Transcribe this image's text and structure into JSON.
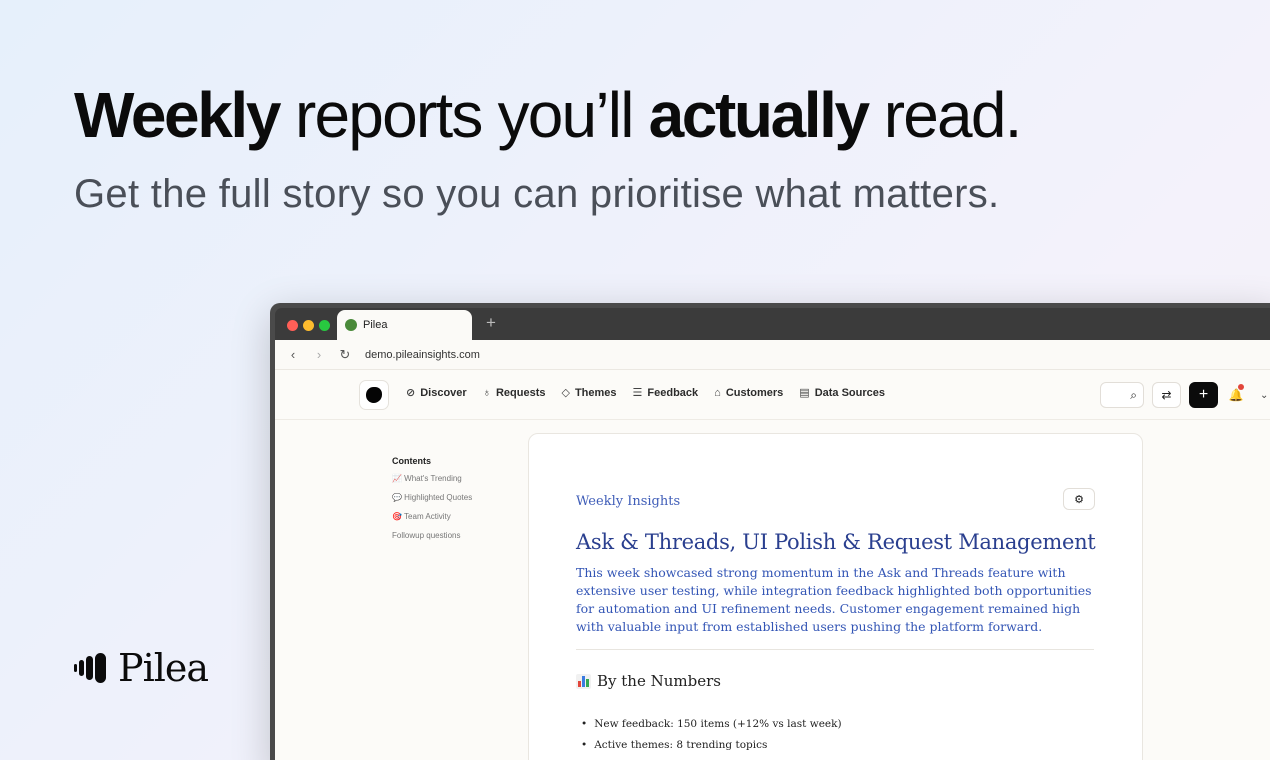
{
  "hero": {
    "headline_part1": "Weekly",
    "headline_part2": " reports you’ll ",
    "headline_part3": "actually",
    "headline_part4": " read.",
    "subline": "Get the full story so you can prioritise what matters."
  },
  "brand": {
    "name": "Pilea"
  },
  "browser": {
    "tab_title": "Pilea",
    "url": "demo.pileainsights.com",
    "colors": {
      "close": "#ff5f57",
      "minimize": "#febc2e",
      "maximize": "#28c840"
    }
  },
  "nav": {
    "items": [
      {
        "label": "Discover",
        "icon": "compass-icon",
        "glyph": "⊘"
      },
      {
        "label": "Requests",
        "icon": "lightbulb-icon",
        "glyph": "♁"
      },
      {
        "label": "Themes",
        "icon": "tag-icon",
        "glyph": "◇"
      },
      {
        "label": "Feedback",
        "icon": "list-icon",
        "glyph": "☰"
      },
      {
        "label": "Customers",
        "icon": "building-icon",
        "glyph": "⌂"
      },
      {
        "label": "Data Sources",
        "icon": "database-icon",
        "glyph": "▤"
      }
    ]
  },
  "toc": {
    "title": "Contents",
    "items": [
      "📈 What's Trending",
      "💬 Highlighted Quotes",
      "🎯 Team Activity",
      "Followup questions"
    ]
  },
  "report": {
    "kicker": "Weekly Insights",
    "title": "Ask & Threads, UI Polish & Request Management",
    "summary": "This week showcased strong momentum in the Ask and Threads feature with extensive user testing, while integration feedback highlighted both opportunities for automation and UI refinement needs. Customer engagement remained high with valuable input from established users pushing the platform forward.",
    "numbers_heading": "By the Numbers",
    "stats": [
      "New feedback: 150 items (+12% vs last week)",
      "Active themes: 8 trending topics"
    ]
  }
}
